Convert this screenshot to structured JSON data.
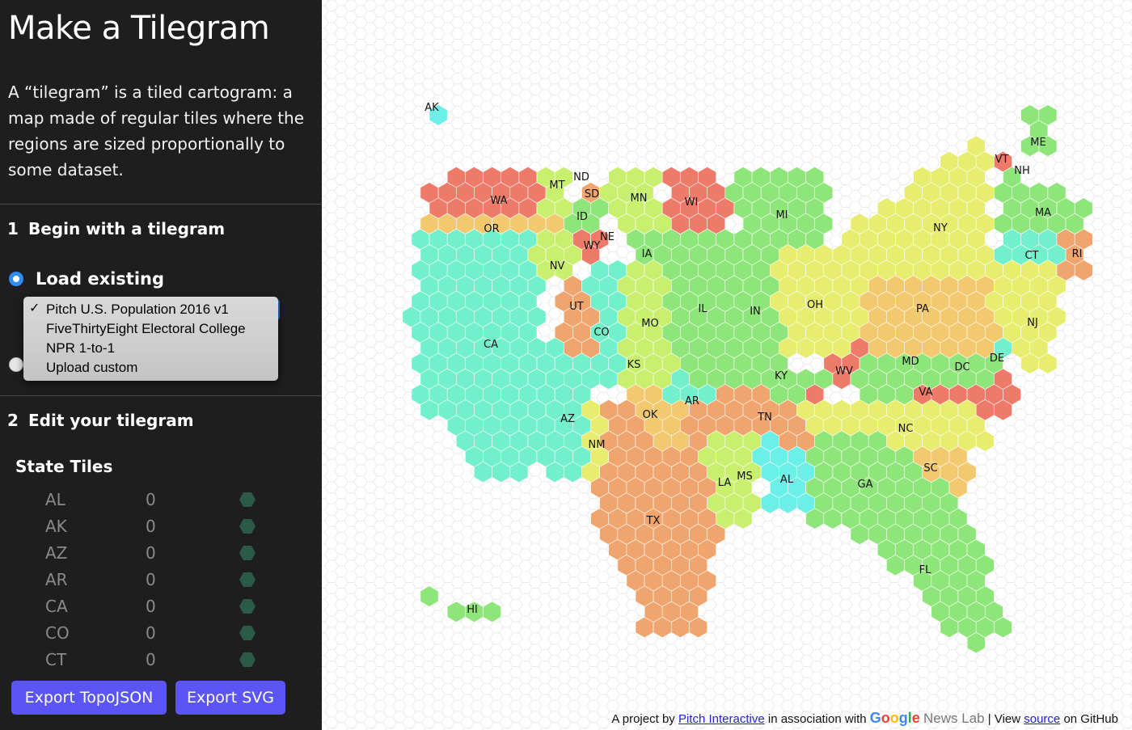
{
  "sidebar": {
    "title": "Make a Tilegram",
    "intro": "A “tilegram” is a tiled cartogram: a map made of regular tiles where the regions are sized proportionally to some dataset.",
    "step1": {
      "number": "1",
      "label": "Begin with a tilegram"
    },
    "load_existing_label": "Load existing",
    "dataset_options": [
      "Pitch U.S. Population 2016 v1",
      "FiveThirtyEight Electoral College",
      "NPR 1-to-1",
      "Upload custom"
    ],
    "selected_option": "Pitch U.S. Population 2016 v1",
    "check_glyph": "✓",
    "step2": {
      "number": "2",
      "label": "Edit your tilegram"
    },
    "state_tiles_heading": "State Tiles",
    "state_rows": [
      {
        "abbr": "AL",
        "value": "0"
      },
      {
        "abbr": "AK",
        "value": "0"
      },
      {
        "abbr": "AZ",
        "value": "0"
      },
      {
        "abbr": "AR",
        "value": "0"
      },
      {
        "abbr": "CA",
        "value": "0"
      },
      {
        "abbr": "CO",
        "value": "0"
      },
      {
        "abbr": "CT",
        "value": "0"
      }
    ],
    "export_topojson_label": "Export TopoJSON",
    "export_svg_label": "Export SVG"
  },
  "map": {
    "state_labels": [
      "AK",
      "ME",
      "VT",
      "NH",
      "ND",
      "MT",
      "WA",
      "SD",
      "MN",
      "WI",
      "MI",
      "ID",
      "NY",
      "MA",
      "OR",
      "WY",
      "NE",
      "IA",
      "CT",
      "RI",
      "NV",
      "OH",
      "PA",
      "UT",
      "IL",
      "IN",
      "NJ",
      "CO",
      "MO",
      "CA",
      "DE",
      "MD",
      "KS",
      "DC",
      "WV",
      "KY",
      "VA",
      "AR",
      "OK",
      "AZ",
      "TN",
      "NC",
      "NM",
      "SC",
      "MS",
      "LA",
      "AL",
      "GA",
      "TX",
      "FL",
      "HI"
    ],
    "palette": {
      "red": "#ee7a6a",
      "orange": "#f0a56e",
      "yellow_orange": "#f2c96e",
      "yellow": "#e7ed6e",
      "yellow_green": "#c8ef6e",
      "green": "#8ee67a",
      "mint": "#6eedb0",
      "aqua": "#72f0cc",
      "cyan": "#6cefe6",
      "grid": "#e9e9e9"
    }
  },
  "footer": {
    "prefix": "A project by",
    "pitch_link": "Pitch Interactive",
    "middle": "in association with",
    "news_lab": "News Lab",
    "view_text": "| View",
    "source_link": "source",
    "suffix": "on GitHub"
  }
}
